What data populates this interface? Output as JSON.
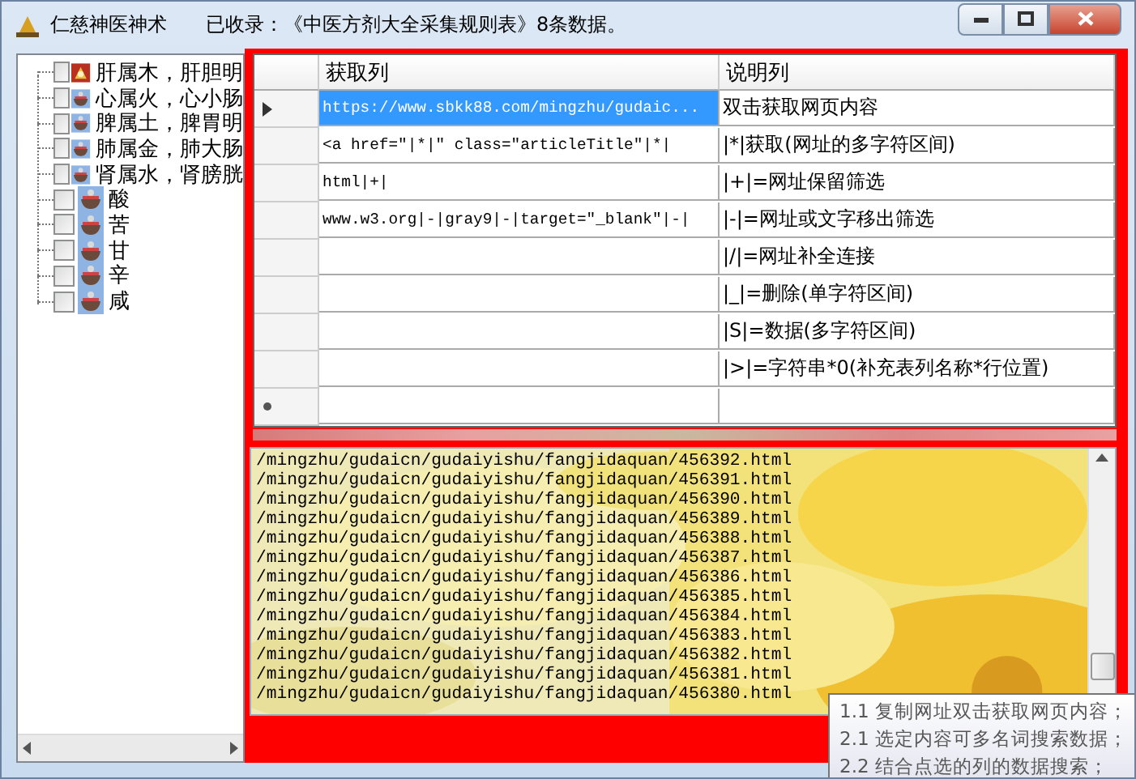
{
  "window": {
    "title": "仁慈神医神术",
    "status": "已收录：《中医方剂大全采集规则表》8条数据。"
  },
  "tree": {
    "items": [
      {
        "label": "肝属木，肝胆明",
        "checked": false,
        "kind": "herb"
      },
      {
        "label": "心属火，心小肠",
        "checked": false,
        "kind": "bowl"
      },
      {
        "label": "脾属土，脾胃明",
        "checked": false,
        "kind": "bowl"
      },
      {
        "label": "肺属金，肺大肠",
        "checked": false,
        "kind": "bowl"
      },
      {
        "label": "肾属水，肾膀胱",
        "checked": false,
        "kind": "bowl"
      },
      {
        "label": "酸",
        "checked": false,
        "kind": "bowl"
      },
      {
        "label": "苦",
        "checked": false,
        "kind": "bowl"
      },
      {
        "label": "甘",
        "checked": false,
        "kind": "bowl"
      },
      {
        "label": "辛",
        "checked": false,
        "kind": "bowl"
      },
      {
        "label": "咸",
        "checked": false,
        "kind": "bowl"
      }
    ]
  },
  "grid": {
    "columns": [
      "获取列",
      "说明列"
    ],
    "rows": [
      {
        "cells": [
          "https://www.sbkk88.com/mingzhu/gudaic...",
          "双击获取网页内容"
        ],
        "selected": true
      },
      {
        "cells": [
          "<a href=\"|*|\" class=\"articleTitle\"|*|",
          "|*|获取(网址的多字符区间)"
        ],
        "selected": false
      },
      {
        "cells": [
          "html|+|",
          "|+|=网址保留筛选"
        ],
        "selected": false
      },
      {
        "cells": [
          "www.w3.org|-|gray9|-|target=\"_blank\"|-|",
          "|-|=网址或文字移出筛选"
        ],
        "selected": false
      },
      {
        "cells": [
          "",
          "|/|=网址补全连接"
        ],
        "selected": false
      },
      {
        "cells": [
          "",
          "|_|=删除(单字符区间)"
        ],
        "selected": false
      },
      {
        "cells": [
          "",
          "|S|=数据(多字符区间)"
        ],
        "selected": false
      },
      {
        "cells": [
          "",
          "|>|=字符串*0(补充表列名称*行位置)"
        ],
        "selected": false
      }
    ]
  },
  "log": {
    "lines": [
      "/mingzhu/gudaicn/gudaiyishu/fangjidaquan/456392.html",
      "/mingzhu/gudaicn/gudaiyishu/fangjidaquan/456391.html",
      "/mingzhu/gudaicn/gudaiyishu/fangjidaquan/456390.html",
      "/mingzhu/gudaicn/gudaiyishu/fangjidaquan/456389.html",
      "/mingzhu/gudaicn/gudaiyishu/fangjidaquan/456388.html",
      "/mingzhu/gudaicn/gudaiyishu/fangjidaquan/456387.html",
      "/mingzhu/gudaicn/gudaiyishu/fangjidaquan/456386.html",
      "/mingzhu/gudaicn/gudaiyishu/fangjidaquan/456385.html",
      "/mingzhu/gudaicn/gudaiyishu/fangjidaquan/456384.html",
      "/mingzhu/gudaicn/gudaiyishu/fangjidaquan/456383.html",
      "/mingzhu/gudaicn/gudaiyishu/fangjidaquan/456382.html",
      "/mingzhu/gudaicn/gudaiyishu/fangjidaquan/456381.html",
      "/mingzhu/gudaicn/gudaiyishu/fangjidaquan/456380.html"
    ]
  },
  "tooltip": {
    "lines": [
      "1.1 复制网址双击获取网页内容；",
      "2.1 选定内容可多名词搜索数据；",
      "2.2 结合点选的列的数据搜索；"
    ]
  }
}
